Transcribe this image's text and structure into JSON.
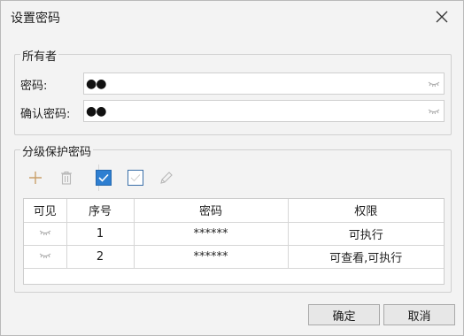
{
  "dialog": {
    "title": "设置密码"
  },
  "owner": {
    "group_title": "所有者",
    "password_label": "密码:",
    "password_value": "●●",
    "confirm_label": "确认密码:",
    "confirm_value": "●●"
  },
  "levels": {
    "group_title": "分级保护密码",
    "columns": [
      "可见",
      "序号",
      "密码",
      "权限"
    ],
    "rows": [
      {
        "index": "1",
        "password": "******",
        "permission": "可执行"
      },
      {
        "index": "2",
        "password": "******",
        "permission": "可查看,可执行"
      }
    ]
  },
  "buttons": {
    "ok": "确定",
    "cancel": "取消"
  },
  "icons": {
    "close": "close-icon",
    "eye": "eye-closed-icon",
    "add": "plus-icon",
    "delete": "trash-icon",
    "check_all": "checkbox-checked-icon",
    "uncheck_all": "checkbox-unchecked-icon",
    "edit": "pencil-icon"
  },
  "colors": {
    "accent": "#2e7fd1",
    "add_icon": "#c9a06a"
  }
}
